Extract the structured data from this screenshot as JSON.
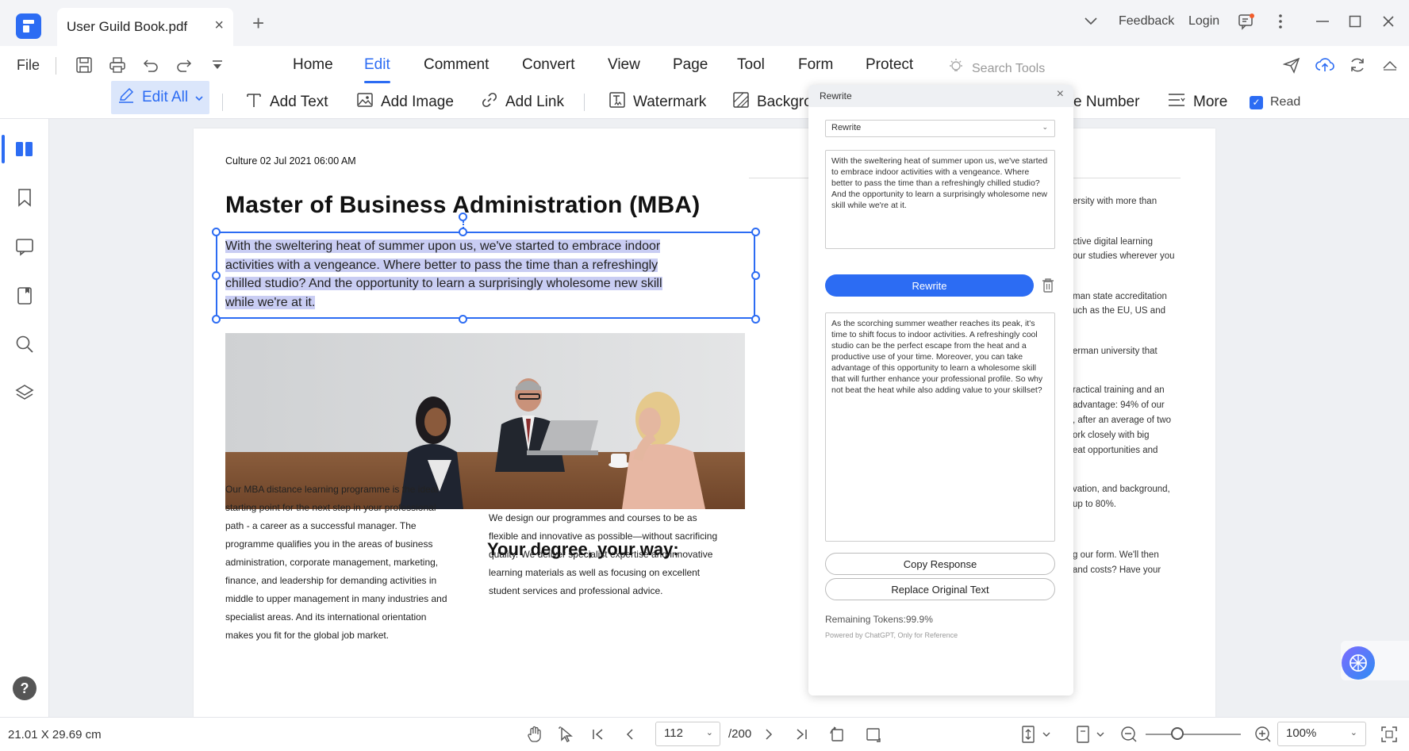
{
  "titlebar": {
    "tab_label": "User Guild Book.pdf",
    "close_glyph": "×",
    "add_glyph": "+",
    "feedback": "Feedback",
    "login": "Login"
  },
  "menu": {
    "file": "File",
    "items": [
      "Home",
      "Edit",
      "Comment",
      "Convert",
      "View",
      "Page",
      "Tool",
      "Form",
      "Protect"
    ],
    "active": "Edit",
    "search_placeholder": "Search Tools"
  },
  "toolbar": {
    "edit_all": "Edit All",
    "add_text": "Add Text",
    "add_image": "Add Image",
    "add_link": "Add Link",
    "watermark": "Watermark",
    "background": "Backgro",
    "page_number": "e Number",
    "more": "More",
    "read": "Read",
    "read_checked": true
  },
  "document": {
    "dateline": "Culture 02 Jul 2021 06:00 AM",
    "title": "Master of Business Administration (MBA)",
    "selected_paragraph": "With the sweltering heat of summer upon us, we've started to embrace indoor activities with a vengeance. Where better to pass the time than a refreshingly chilled studio? And the opportunity to learn a surprisingly wholesome new skill while we're at it.",
    "body_left": "Our MBA distance learning programme is the ideal starting point for the next step in your professional path - a career as a successful manager. The programme qualifies you in the areas of business administration, corporate management, marketing, finance, and leadership for demanding activities in middle to upper management in many industries and specialist areas. And its international orientation makes you fit for the global job market.",
    "section_title": "Your degree, your way:",
    "body_right": "We design our programmes and courses to be as flexible and innovative as possible—without sacrificing quality. We deliver specialist expertise and innovative learning materials as well as focusing on excellent student services and professional advice.",
    "right_fragments": [
      "ersity with more than",
      "ctive digital learning",
      "our studies wherever you",
      "man state accreditation",
      "uch as the EU, US and",
      "erman university that",
      "ractical training and an",
      "advantage: 94% of our",
      ", after an average of two",
      "ork closely with big",
      "eat opportunities and",
      "vation, and background,",
      "up to 80%.",
      "g our form. We'll then",
      "and costs? Have your"
    ]
  },
  "rewrite_panel": {
    "title": "Rewrite",
    "mode_selected": "Rewrite",
    "input_text": "With the sweltering heat of summer upon us, we've started to embrace indoor activities with a vengeance. Where better to pass the time than a refreshingly chilled studio? And the opportunity to learn a surprisingly wholesome new skill while we're at it.",
    "rewrite_button": "Rewrite",
    "output_text": "As the scorching summer weather reaches its peak, it's time to shift focus to indoor activities. A refreshingly cool studio can be the perfect escape from the heat and a productive use of your time. Moreover, you can take advantage of this opportunity to learn a wholesome skill that will further enhance your professional profile. So why not beat the heat while also adding value to your skillset?",
    "copy_button": "Copy Response",
    "replace_button": "Replace Original Text",
    "tokens": "Remaining Tokens:99.9%",
    "powered_by": "Powered by ChatGPT, Only for Reference"
  },
  "statusbar": {
    "dimensions": "21.01 X 29.69 cm",
    "current_page": "112",
    "total_pages": "/200",
    "zoom": "100%",
    "zoom_fraction": 0.3
  },
  "colors": {
    "accent": "#2c6cf3",
    "selection": "#c9cdf3"
  }
}
